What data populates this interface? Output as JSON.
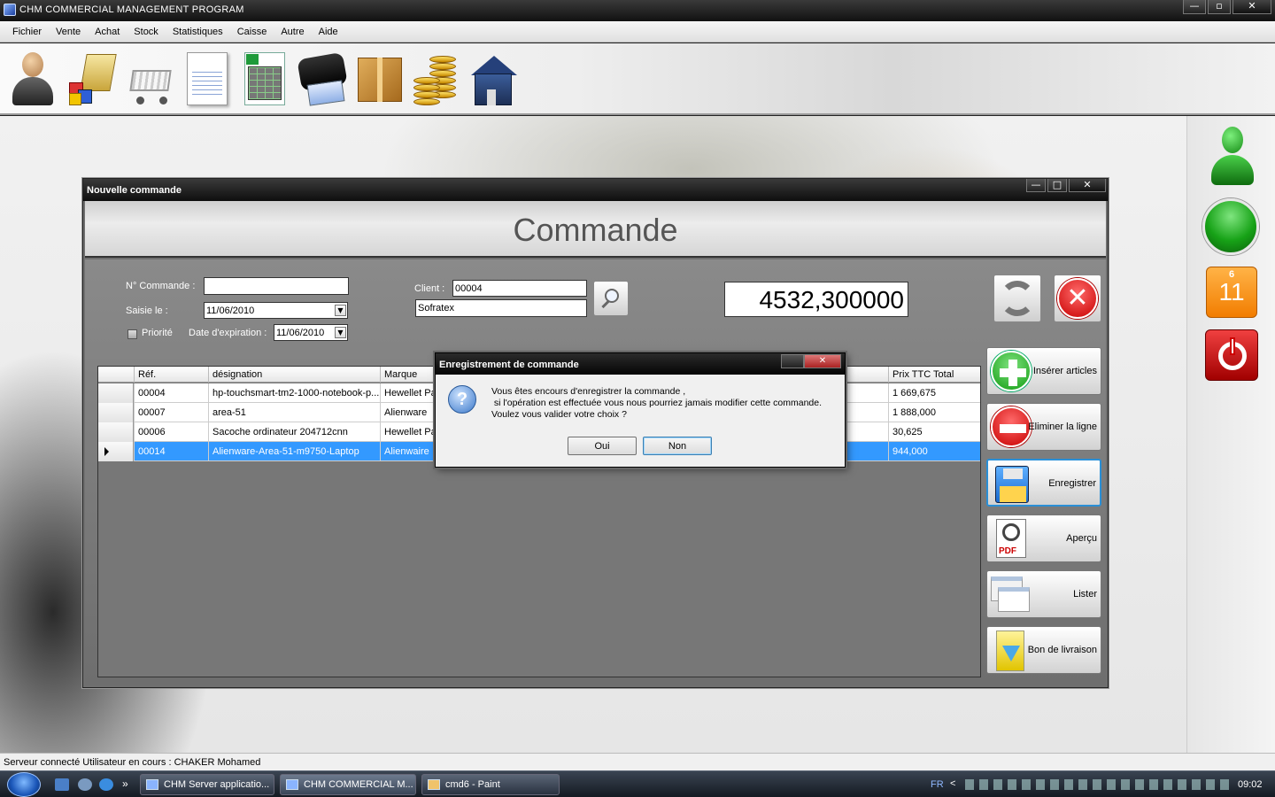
{
  "app": {
    "title": "CHM COMMERCIAL MANAGEMENT PROGRAM",
    "window_buttons": [
      "—",
      "▫",
      "✕"
    ]
  },
  "menu": [
    "Fichier",
    "Vente",
    "Achat",
    "Stock",
    "Statistiques",
    "Caisse",
    "Autre",
    "Aide"
  ],
  "toolbar_icons": [
    "user-icon",
    "products-icon",
    "cart-icon",
    "invoice-icon",
    "spreadsheet-icon",
    "wallet-icon",
    "package-icon",
    "coins-icon",
    "home-icon"
  ],
  "side_panel": {
    "calendar_month": "6",
    "calendar_day": "11"
  },
  "window": {
    "title": "Nouvelle commande",
    "heading": "Commande",
    "buttons": [
      "—",
      "□",
      "✕"
    ]
  },
  "form": {
    "commande_label": "N° Commande :",
    "commande_value": "",
    "saisie_label": "Saisie le :",
    "saisie_value": "11/06/2010",
    "priorite_label": "Priorité",
    "expiration_label": "Date d'expiration :",
    "expiration_value": "11/06/2010",
    "client_label": "Client :",
    "client_code": "00004",
    "client_name": "Sofratex",
    "total": "4532,300000"
  },
  "grid": {
    "columns": [
      "Réf.",
      "désignation",
      "Marque",
      "Prix TTC Total"
    ],
    "rows": [
      {
        "ref": "00004",
        "designation": "hp-touchsmart-tm2-1000-notebook-p...",
        "marque": "Hewellet Pac",
        "total": "1 669,675"
      },
      {
        "ref": "00007",
        "designation": "area-51",
        "marque": "Alienware",
        "total": "1 888,000"
      },
      {
        "ref": "00006",
        "designation": "Sacoche ordinateur 204712cnn",
        "marque": "Hewellet Pac",
        "total": "30,625"
      },
      {
        "ref": "00014",
        "designation": "Alienware-Area-51-m9750-Laptop",
        "marque": "Alienwaire",
        "total": "944,000"
      }
    ]
  },
  "actions": {
    "inserer": "Insérer articles",
    "eliminer": "Eliminer la ligne",
    "enregistrer": "Enregistrer",
    "apercu": "Aperçu",
    "lister": "Lister",
    "bon_livraison": "Bon de livraison",
    "pdf_badge": "PDF"
  },
  "dialog": {
    "title": "Enregistrement de commande",
    "question_mark": "?",
    "message": "Vous êtes encours d'enregistrer la commande ,\n si l'opération est effectuée vous nous pourriez jamais modifier cette commande.\nVoulez vous valider votre choix ?",
    "yes": "Oui",
    "no": "Non"
  },
  "status": {
    "text": "Serveur connecté   Utilisateur en cours : CHAKER Mohamed"
  },
  "taskbar": {
    "tasks": [
      "CHM Server applicatio...",
      "CHM COMMERCIAL M...",
      "cmd6 - Paint"
    ],
    "quicklaunch_more": "»",
    "language": "FR",
    "tray_chevron": "<",
    "clock": "09:02"
  }
}
